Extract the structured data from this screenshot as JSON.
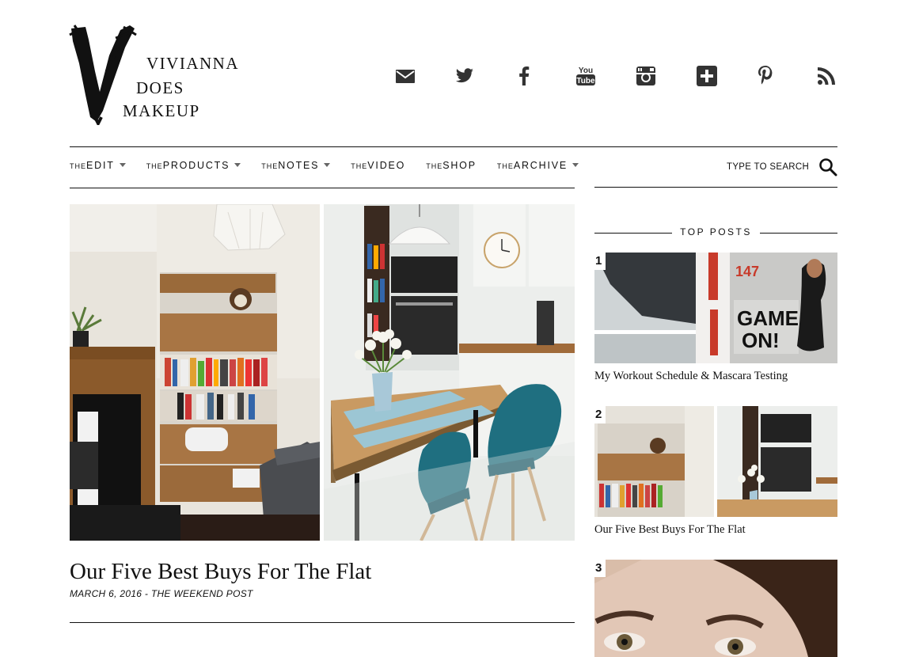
{
  "brand": {
    "line1": "VIVIANNA",
    "line2": "DOES",
    "line3": "MAKEUP"
  },
  "social": [
    "email-icon",
    "twitter-icon",
    "facebook-icon",
    "youtube-icon",
    "instagram-icon",
    "bloglovin-icon",
    "pinterest-icon",
    "rss-icon"
  ],
  "youtube_text": {
    "you": "You",
    "tube": "Tube"
  },
  "nav": {
    "prefix": "THE",
    "items": [
      {
        "label": "EDIT",
        "dropdown": true
      },
      {
        "label": "PRODUCTS",
        "dropdown": true
      },
      {
        "label": "NOTES",
        "dropdown": true
      },
      {
        "label": "VIDEO",
        "dropdown": false
      },
      {
        "label": "SHOP",
        "dropdown": false
      },
      {
        "label": "ARCHIVE",
        "dropdown": true
      }
    ],
    "search_label": "TYPE TO SEARCH"
  },
  "featured": {
    "title": "Our Five Best Buys For The Flat",
    "meta": "MARCH 6, 2016 - THE WEEKEND POST"
  },
  "sidebar": {
    "heading": "TOP POSTS",
    "posts": [
      {
        "rank": "1",
        "title": "My Workout Schedule & Mascara Testing",
        "magazine_num": "147",
        "magazine_headline1": "GAME",
        "magazine_headline2": "ON!"
      },
      {
        "rank": "2",
        "title": "Our Five Best Buys For The Flat"
      },
      {
        "rank": "3",
        "title": ""
      }
    ]
  },
  "colors": {
    "text": "#111111",
    "rule": "#111111",
    "teal": "#1f6f80"
  }
}
